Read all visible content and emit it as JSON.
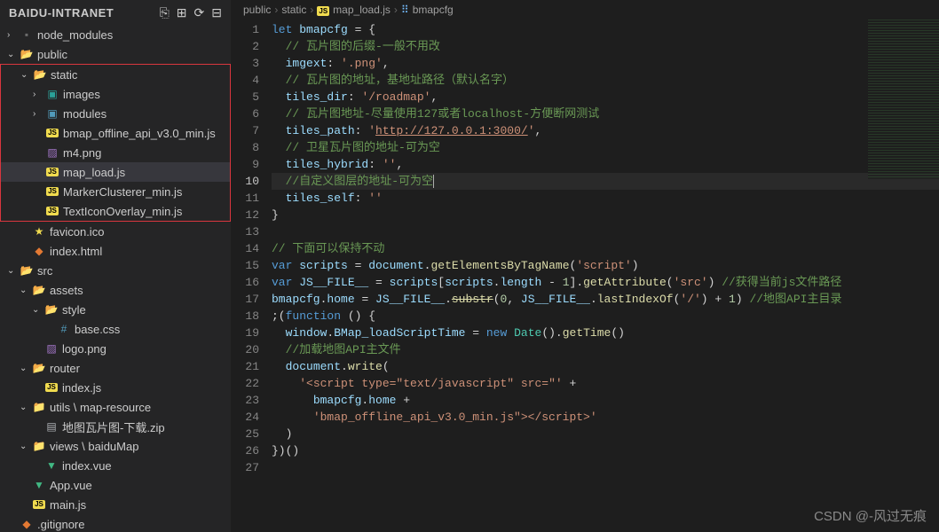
{
  "sidebar": {
    "title": "BAIDU-INTRANET",
    "actions": [
      "new-file",
      "new-folder",
      "refresh",
      "collapse"
    ],
    "tree": [
      {
        "depth": 0,
        "chev": "›",
        "icon": "gray-folder",
        "label": "node_modules"
      },
      {
        "depth": 0,
        "chev": "⌄",
        "icon": "folder-open",
        "label": "public"
      },
      {
        "depth": 1,
        "chev": "⌄",
        "icon": "folder-open",
        "label": "static",
        "boxStart": true
      },
      {
        "depth": 2,
        "chev": "›",
        "icon": "folder-img",
        "label": "images"
      },
      {
        "depth": 2,
        "chev": "›",
        "icon": "folder-mod",
        "label": "modules"
      },
      {
        "depth": 2,
        "chev": "",
        "icon": "js",
        "label": "bmap_offline_api_v3.0_min.js"
      },
      {
        "depth": 2,
        "chev": "",
        "icon": "img",
        "label": "m4.png"
      },
      {
        "depth": 2,
        "chev": "",
        "icon": "js",
        "label": "map_load.js",
        "active": true
      },
      {
        "depth": 2,
        "chev": "",
        "icon": "js",
        "label": "MarkerClusterer_min.js"
      },
      {
        "depth": 2,
        "chev": "",
        "icon": "js",
        "label": "TextIconOverlay_min.js",
        "boxEnd": true
      },
      {
        "depth": 1,
        "chev": "",
        "icon": "star",
        "label": "favicon.ico"
      },
      {
        "depth": 1,
        "chev": "",
        "icon": "html",
        "label": "index.html"
      },
      {
        "depth": 0,
        "chev": "⌄",
        "icon": "folder-open",
        "label": "src"
      },
      {
        "depth": 1,
        "chev": "⌄",
        "icon": "folder-open",
        "label": "assets"
      },
      {
        "depth": 2,
        "chev": "⌄",
        "icon": "folder-open",
        "label": "style"
      },
      {
        "depth": 3,
        "chev": "",
        "icon": "css",
        "label": "base.css"
      },
      {
        "depth": 2,
        "chev": "",
        "icon": "img",
        "label": "logo.png"
      },
      {
        "depth": 1,
        "chev": "⌄",
        "icon": "folder-open",
        "label": "router"
      },
      {
        "depth": 2,
        "chev": "",
        "icon": "js",
        "label": "index.js"
      },
      {
        "depth": 1,
        "chev": "⌄",
        "icon": "folder",
        "label": "utils \\ map-resource"
      },
      {
        "depth": 2,
        "chev": "",
        "icon": "zip",
        "label": "地图瓦片图-下载.zip"
      },
      {
        "depth": 1,
        "chev": "⌄",
        "icon": "folder",
        "label": "views \\ baiduMap"
      },
      {
        "depth": 2,
        "chev": "",
        "icon": "vue",
        "label": "index.vue"
      },
      {
        "depth": 1,
        "chev": "",
        "icon": "vue",
        "label": "App.vue"
      },
      {
        "depth": 1,
        "chev": "",
        "icon": "js",
        "label": "main.js"
      },
      {
        "depth": 0,
        "chev": "",
        "icon": "git",
        "label": ".gitignore"
      }
    ]
  },
  "breadcrumb": [
    "public",
    "static",
    "map_load.js",
    "bmapcfg"
  ],
  "breadcrumb_icons": [
    "",
    "",
    "js",
    "var"
  ],
  "code": {
    "active_line": 10,
    "lines": [
      [
        [
          "kw",
          "let"
        ],
        [
          "pl",
          " "
        ],
        [
          "var",
          "bmapcfg"
        ],
        [
          "pl",
          " = "
        ],
        [
          "pl",
          "{"
        ]
      ],
      [
        [
          "pl",
          "  "
        ],
        [
          "cmt",
          "// 瓦片图的后缀-一般不用改"
        ]
      ],
      [
        [
          "pl",
          "  "
        ],
        [
          "var",
          "imgext"
        ],
        [
          "pl",
          ": "
        ],
        [
          "str",
          "'.png'"
        ],
        [
          "pl",
          ","
        ]
      ],
      [
        [
          "pl",
          "  "
        ],
        [
          "cmt",
          "// 瓦片图的地址，基地址路径（默认名字）"
        ]
      ],
      [
        [
          "pl",
          "  "
        ],
        [
          "var",
          "tiles_dir"
        ],
        [
          "pl",
          ": "
        ],
        [
          "str",
          "'/roadmap'"
        ],
        [
          "pl",
          ","
        ]
      ],
      [
        [
          "pl",
          "  "
        ],
        [
          "cmt",
          "// 瓦片图地址-尽量使用127或者localhost-方便断网测试"
        ]
      ],
      [
        [
          "pl",
          "  "
        ],
        [
          "var",
          "tiles_path"
        ],
        [
          "pl",
          ": "
        ],
        [
          "str",
          "'"
        ],
        [
          "url",
          "http://127.0.0.1:3000/"
        ],
        [
          "str",
          "'"
        ],
        [
          "pl",
          ","
        ]
      ],
      [
        [
          "pl",
          "  "
        ],
        [
          "cmt",
          "// 卫星瓦片图的地址-可为空"
        ]
      ],
      [
        [
          "pl",
          "  "
        ],
        [
          "var",
          "tiles_hybrid"
        ],
        [
          "pl",
          ": "
        ],
        [
          "str",
          "''"
        ],
        [
          "pl",
          ","
        ]
      ],
      [
        [
          "pl",
          "  "
        ],
        [
          "cmt",
          "//自定义图层的地址-可为空"
        ],
        [
          "cursor",
          ""
        ]
      ],
      [
        [
          "pl",
          "  "
        ],
        [
          "var",
          "tiles_self"
        ],
        [
          "pl",
          ": "
        ],
        [
          "str",
          "''"
        ]
      ],
      [
        [
          "pl",
          "}"
        ]
      ],
      [],
      [
        [
          "cmt",
          "// 下面可以保持不动"
        ]
      ],
      [
        [
          "kw",
          "var"
        ],
        [
          "pl",
          " "
        ],
        [
          "var",
          "scripts"
        ],
        [
          "pl",
          " = "
        ],
        [
          "var",
          "document"
        ],
        [
          "pl",
          "."
        ],
        [
          "fn",
          "getElementsByTagName"
        ],
        [
          "pl",
          "("
        ],
        [
          "str",
          "'script'"
        ],
        [
          "pl",
          ")"
        ]
      ],
      [
        [
          "kw",
          "var"
        ],
        [
          "pl",
          " "
        ],
        [
          "var",
          "JS__FILE__"
        ],
        [
          "pl",
          " = "
        ],
        [
          "var",
          "scripts"
        ],
        [
          "pl",
          "["
        ],
        [
          "var",
          "scripts"
        ],
        [
          "pl",
          "."
        ],
        [
          "var",
          "length"
        ],
        [
          "pl",
          " - "
        ],
        [
          "num",
          "1"
        ],
        [
          "pl",
          "]."
        ],
        [
          "fn",
          "getAttribute"
        ],
        [
          "pl",
          "("
        ],
        [
          "str",
          "'src'"
        ],
        [
          "pl",
          ") "
        ],
        [
          "cmt",
          "//获得当前js文件路径"
        ]
      ],
      [
        [
          "var",
          "bmapcfg"
        ],
        [
          "pl",
          "."
        ],
        [
          "var",
          "home"
        ],
        [
          "pl",
          " = "
        ],
        [
          "var",
          "JS__FILE__"
        ],
        [
          "pl",
          "."
        ],
        [
          "fn-strike",
          "substr"
        ],
        [
          "pl",
          "("
        ],
        [
          "num",
          "0"
        ],
        [
          "pl",
          ", "
        ],
        [
          "var",
          "JS__FILE__"
        ],
        [
          "pl",
          "."
        ],
        [
          "fn",
          "lastIndexOf"
        ],
        [
          "pl",
          "("
        ],
        [
          "str",
          "'/'"
        ],
        [
          "pl",
          ") + "
        ],
        [
          "num",
          "1"
        ],
        [
          "pl",
          ") "
        ],
        [
          "cmt",
          "//地图API主目录"
        ]
      ],
      [
        [
          "pl",
          ";("
        ],
        [
          "kw",
          "function"
        ],
        [
          "pl",
          " () {"
        ]
      ],
      [
        [
          "pl",
          "  "
        ],
        [
          "var",
          "window"
        ],
        [
          "pl",
          "."
        ],
        [
          "var",
          "BMap_loadScriptTime"
        ],
        [
          "pl",
          " = "
        ],
        [
          "kw",
          "new"
        ],
        [
          "pl",
          " "
        ],
        [
          "type",
          "Date"
        ],
        [
          "pl",
          "()."
        ],
        [
          "fn",
          "getTime"
        ],
        [
          "pl",
          "()"
        ]
      ],
      [
        [
          "pl",
          "  "
        ],
        [
          "cmt",
          "//加载地图API主文件"
        ]
      ],
      [
        [
          "pl",
          "  "
        ],
        [
          "var",
          "document"
        ],
        [
          "pl",
          "."
        ],
        [
          "fn",
          "write"
        ],
        [
          "pl",
          "("
        ]
      ],
      [
        [
          "pl",
          "    "
        ],
        [
          "str",
          "'<script type=\"text/javascript\" src=\"'"
        ],
        [
          "pl",
          " +"
        ]
      ],
      [
        [
          "pl",
          "      "
        ],
        [
          "var",
          "bmapcfg"
        ],
        [
          "pl",
          "."
        ],
        [
          "var",
          "home"
        ],
        [
          "pl",
          " +"
        ]
      ],
      [
        [
          "pl",
          "      "
        ],
        [
          "str",
          "'bmap_offline_api_v3.0_min.js\"></script>'"
        ]
      ],
      [
        [
          "pl",
          "  )"
        ]
      ],
      [
        [
          "pl",
          "})()"
        ]
      ],
      []
    ]
  },
  "watermark": "CSDN @-风过无痕"
}
